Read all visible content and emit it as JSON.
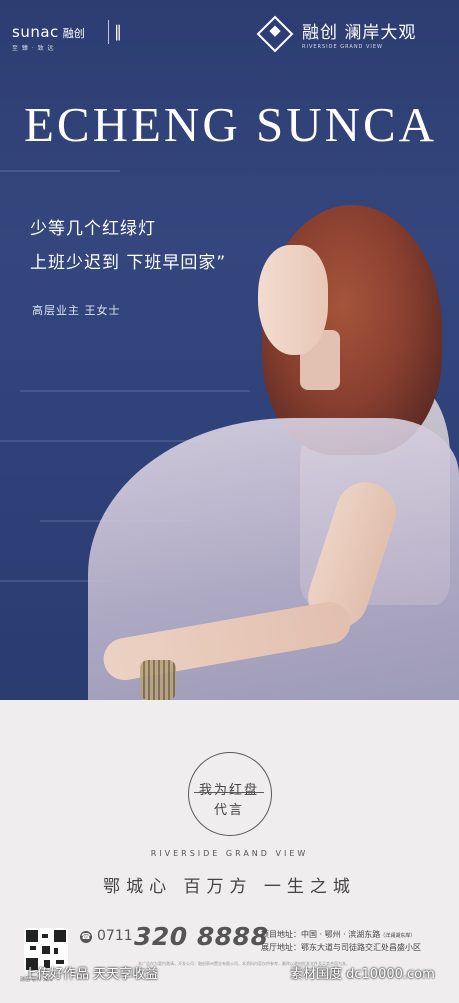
{
  "header": {
    "brand_left": "sunac",
    "brand_left_cn": "融创",
    "brand_left_tag": "至 臻 · 致 远",
    "brand_right_name": "融创 澜岸大观",
    "brand_right_sub": "RIVERSIDE GRAND VIEW"
  },
  "hero": {
    "headline": "ECHENG SUNCA",
    "quote_line1": "少等几个红绿灯",
    "quote_line2": "上班少迟到 下班早回家”",
    "attribution": "高层业主 王女士"
  },
  "badge": {
    "line1": "我为红盘",
    "line2": "代言"
  },
  "footer": {
    "riverside": "RIVERSIDE GRAND VIEW",
    "slogan": "鄂城心   百万方   一生之城",
    "qr_caption": "融创·鄂州·澜岸",
    "area_code": "0711",
    "phone": "320 8888",
    "address_project": "项目地址：中国 · 鄂州 · 滨湖东路",
    "address_project_note": "（洋澜湖东岸）",
    "address_sales": "展厅地址：鄂东大道与司徒路交汇处昌盛小区",
    "disclaimer": "本广告仅为要约邀请，开发公司：融创鄂州置业有限公司，本资料内容仅供参考，最终以政府批准文件及买卖合同为准。"
  },
  "watermark": {
    "left": "上传好作品 天天享收益",
    "right": "素材国度 dc10000.com"
  },
  "colors": {
    "hero_bg": "#2f427a",
    "bottom_bg": "#efedee",
    "text_dark": "#444444"
  }
}
